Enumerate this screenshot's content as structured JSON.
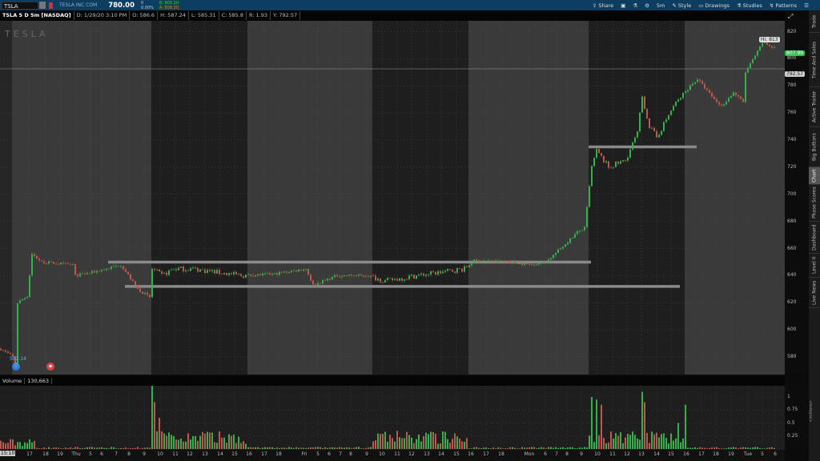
{
  "topbar": {
    "symbol": "TSLA",
    "company": "TESLA INC COM",
    "last": "780.00",
    "change": "0",
    "change_pct": "0.00%",
    "bid": "B: 805.10",
    "ask": "A: 808.30"
  },
  "tools": [
    "Share",
    "Notes",
    "Flask",
    "Settings",
    "5m",
    "Style",
    "Drawings",
    "Studies",
    "Patterns"
  ],
  "header": {
    "title": "TSLA 5 D 5m [NASDAQ]",
    "date": "D: 1/29/20 3:10 PM",
    "open": "O: 586.6",
    "high": "H: 587.24",
    "low": "L: 585.31",
    "close": "C: 585.8",
    "range": "R: 1.93",
    "y": "Y: 792.57"
  },
  "watermark": "TESLA",
  "price_axis": {
    "ticks": [
      820,
      800,
      780,
      760,
      740,
      720,
      700,
      680,
      660,
      640,
      620,
      600,
      580
    ],
    "range": [
      567,
      828
    ]
  },
  "labels": {
    "high": "Hi: 813",
    "last_price": "807.99",
    "y_price": "792.57",
    "low_marker": "582.14"
  },
  "colors": {
    "up": "#2fb34a",
    "down": "#c0574d",
    "session": "#1e1e1e",
    "ext": "#3a3a3a"
  },
  "price_keypoints": [
    [
      0,
      586
    ],
    [
      5,
      580
    ],
    [
      6,
      573
    ],
    [
      7,
      620
    ],
    [
      11,
      625
    ],
    [
      13,
      656
    ],
    [
      17,
      650
    ],
    [
      30,
      648
    ],
    [
      31,
      640
    ],
    [
      37,
      642
    ],
    [
      44,
      645
    ],
    [
      50,
      648
    ],
    [
      57,
      630
    ],
    [
      62,
      624
    ],
    [
      63,
      645
    ],
    [
      67,
      640
    ],
    [
      72,
      645
    ],
    [
      80,
      645
    ],
    [
      100,
      640
    ],
    [
      113,
      641
    ],
    [
      127,
      645
    ],
    [
      130,
      633
    ],
    [
      140,
      640
    ],
    [
      153,
      640
    ],
    [
      160,
      636
    ],
    [
      173,
      640
    ],
    [
      193,
      645
    ],
    [
      197,
      651
    ],
    [
      213,
      650
    ],
    [
      220,
      648
    ],
    [
      227,
      650
    ],
    [
      233,
      660
    ],
    [
      240,
      672
    ],
    [
      243,
      675
    ],
    [
      246,
      720
    ],
    [
      248,
      732
    ],
    [
      253,
      720
    ],
    [
      260,
      725
    ],
    [
      265,
      745
    ],
    [
      267,
      772
    ],
    [
      270,
      750
    ],
    [
      273,
      742
    ],
    [
      280,
      765
    ],
    [
      287,
      780
    ],
    [
      290,
      785
    ],
    [
      297,
      770
    ],
    [
      300,
      765
    ],
    [
      305,
      775
    ],
    [
      309,
      768
    ],
    [
      310,
      790
    ],
    [
      312,
      796
    ],
    [
      315,
      805
    ],
    [
      317,
      812
    ],
    [
      322,
      808
    ]
  ],
  "support_lines": [
    {
      "price": 650,
      "from_bar": 45,
      "to_bar": 246
    },
    {
      "price": 632,
      "from_bar": 52,
      "to_bar": 283
    },
    {
      "price": 735,
      "from_bar": 245,
      "to_bar": 290
    }
  ],
  "volume": {
    "header": "Volume",
    "value": "130,663",
    "ticks": [
      "1",
      "0.75",
      "0.5",
      "0.25"
    ],
    "unit": "<millions>",
    "spikes": [
      [
        63,
        1.25
      ],
      [
        64,
        0.9
      ],
      [
        66,
        0.6
      ],
      [
        246,
        1.0
      ],
      [
        248,
        0.95
      ],
      [
        250,
        0.85
      ],
      [
        267,
        1.1
      ],
      [
        268,
        0.9
      ],
      [
        285,
        0.85
      ],
      [
        282,
        0.5
      ]
    ]
  },
  "time_axis": {
    "current": "15:10",
    "ticks": [
      [
        "17",
        37
      ],
      [
        "18",
        57
      ],
      [
        "19",
        75
      ],
      [
        "Thu",
        95
      ],
      [
        "5",
        113
      ],
      [
        "6",
        127
      ],
      [
        "7",
        145
      ],
      [
        "8",
        161
      ],
      [
        "9",
        180
      ],
      [
        "10",
        200
      ],
      [
        "11",
        219
      ],
      [
        "12",
        237
      ],
      [
        "13",
        256
      ],
      [
        "14",
        275
      ],
      [
        "15",
        293
      ],
      [
        "16",
        311
      ],
      [
        "17",
        330
      ],
      [
        "18",
        348
      ],
      [
        "Fri",
        380
      ],
      [
        "5",
        397
      ],
      [
        "6",
        411
      ],
      [
        "7",
        425
      ],
      [
        "8",
        438
      ],
      [
        "9",
        458
      ],
      [
        "10",
        477
      ],
      [
        "11",
        496
      ],
      [
        "12",
        514
      ],
      [
        "13",
        533
      ],
      [
        "14",
        551
      ],
      [
        "15",
        570
      ],
      [
        "16",
        588
      ],
      [
        "17",
        607
      ],
      [
        "18",
        626
      ],
      [
        "Mon",
        661
      ],
      [
        "6",
        681
      ],
      [
        "7",
        695
      ],
      [
        "8",
        708
      ],
      [
        "9",
        726
      ],
      [
        "10",
        746
      ],
      [
        "11",
        765
      ],
      [
        "12",
        783
      ],
      [
        "13",
        801
      ],
      [
        "14",
        820
      ],
      [
        "15",
        838
      ],
      [
        "16",
        857
      ],
      [
        "17",
        876
      ],
      [
        "18",
        894
      ],
      [
        "19",
        913
      ],
      [
        "Tue",
        934
      ],
      [
        "5",
        952
      ],
      [
        "6",
        968
      ]
    ]
  },
  "tabs": [
    "Trade",
    "Time And Sales",
    "Active Trader",
    "Big Buttons",
    "Chart",
    "Phase Scores",
    "Dashboard",
    "Level II",
    "Live News"
  ]
}
